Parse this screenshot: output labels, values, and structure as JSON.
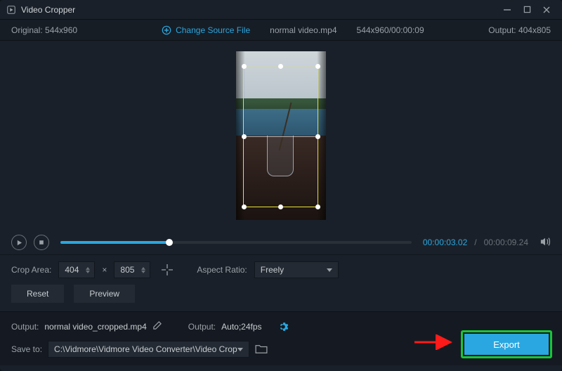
{
  "titlebar": {
    "title": "Video Cropper"
  },
  "infobar": {
    "original_label": "Original:",
    "original_dims": "544x960",
    "change_source": "Change Source File",
    "filename": "normal video.mp4",
    "filedims": "544x960/00:00:09",
    "output_label": "Output:",
    "output_dims": "404x805"
  },
  "playback": {
    "current": "00:00:03.02",
    "sep": "/",
    "duration": "00:00:09.24"
  },
  "crop": {
    "area_label": "Crop Area:",
    "w": "404",
    "h": "805",
    "aspect_label": "Aspect Ratio:",
    "aspect_value": "Freely",
    "reset": "Reset",
    "preview": "Preview"
  },
  "bottom": {
    "output_label": "Output:",
    "output_file": "normal video_cropped.mp4",
    "settings_label": "Output:",
    "settings_value": "Auto;24fps",
    "save_label": "Save to:",
    "save_path": "C:\\Vidmore\\Vidmore Video Converter\\Video Crop",
    "export": "Export"
  },
  "icons": {
    "center": "center-crop-icon",
    "gear": "gear-icon",
    "folder": "open-folder-icon"
  }
}
